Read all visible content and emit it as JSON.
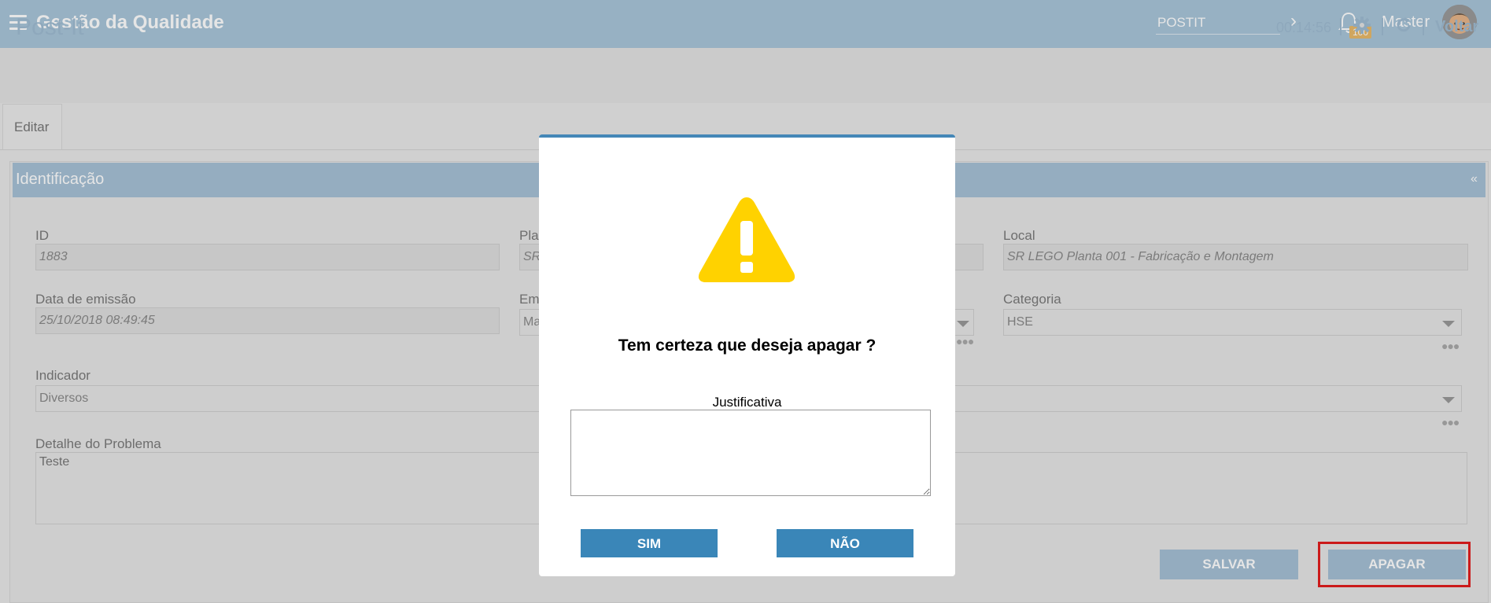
{
  "app": {
    "title": "Gestão da Qualidade"
  },
  "topbar": {
    "search_value": "POSTIT",
    "notifications_count": "100",
    "user_name": "Master"
  },
  "page": {
    "title": "Post-It",
    "timer": "00:14:56",
    "back_label": "Voltar"
  },
  "tabs": [
    {
      "label": "Editar"
    }
  ],
  "section": {
    "title": "Identificação",
    "collapse_glyph": "«"
  },
  "form": {
    "id_label": "ID",
    "id_value": "1883",
    "planta_label_partial": "Pla",
    "planta_value_partial": "SR",
    "local_label": "Local",
    "local_value": "SR LEGO Planta 001 - Fabricação e Montagem",
    "data_label": "Data de emissão",
    "data_value": "25/10/2018 08:49:45",
    "emitente_label_partial": "Em",
    "emitente_value_partial": "Ma",
    "categoria_label": "Categoria",
    "categoria_value": "HSE",
    "indicador_label": "Indicador",
    "indicador_value": "Diversos",
    "detalhe_label": "Detalhe do Problema",
    "detalhe_value": "Teste"
  },
  "actions": {
    "save_label": "SALVAR",
    "delete_label": "APAGAR"
  },
  "modal": {
    "question": "Tem certeza que deseja apagar ?",
    "justification_label": "Justificativa",
    "justification_value": "",
    "yes_label": "SIM",
    "no_label": "NÃO"
  },
  "colors": {
    "topbar": "#a9c6da",
    "modal_accent": "#3a86b8",
    "warning": "#ffd200",
    "highlight": "#e31d1d"
  },
  "icons": [
    "menu-icon",
    "chevron-right-icon",
    "bell-icon",
    "avatar",
    "gear-icon",
    "refresh-icon",
    "warning-icon"
  ]
}
